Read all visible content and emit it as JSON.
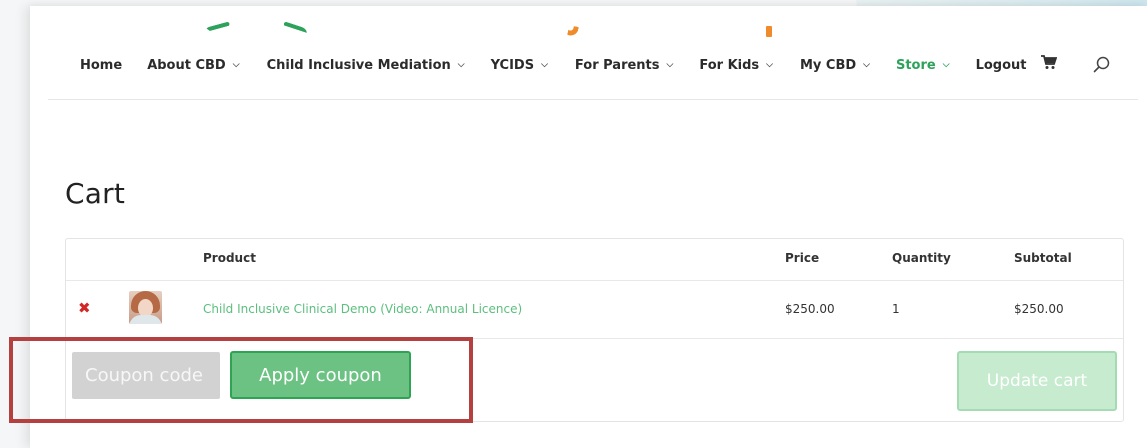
{
  "nav": {
    "items": [
      {
        "label": "Home",
        "has_dropdown": false,
        "active": false
      },
      {
        "label": "About CBD",
        "has_dropdown": true,
        "active": false
      },
      {
        "label": "Child Inclusive Mediation",
        "has_dropdown": true,
        "active": false
      },
      {
        "label": "YCIDS",
        "has_dropdown": true,
        "active": false
      },
      {
        "label": "For Parents",
        "has_dropdown": true,
        "active": false
      },
      {
        "label": "For Kids",
        "has_dropdown": true,
        "active": false
      },
      {
        "label": "My CBD",
        "has_dropdown": true,
        "active": false
      },
      {
        "label": "Store",
        "has_dropdown": true,
        "active": true
      },
      {
        "label": "Logout",
        "has_dropdown": false,
        "active": false
      }
    ],
    "dropdown_icon": "chevron-down-icon",
    "cart_icon": "cart-icon",
    "search_icon": "search-icon",
    "active_color": "#2ca25a"
  },
  "page": {
    "title": "Cart"
  },
  "cart": {
    "columns": {
      "product": "Product",
      "price": "Price",
      "quantity": "Quantity",
      "subtotal": "Subtotal"
    },
    "items": [
      {
        "remove_icon": "close-icon",
        "product_name": "Child Inclusive Clinical Demo (Video: Annual Licence)",
        "price": "$250.00",
        "quantity": "1",
        "subtotal": "$250.00"
      }
    ],
    "coupon": {
      "placeholder": "Coupon code",
      "value": ""
    },
    "apply_coupon_label": "Apply coupon",
    "update_cart_label": "Update cart"
  },
  "colors": {
    "brand_green": "#2ca25a",
    "link_green": "#5cbf7e",
    "button_green": "#6cc283",
    "remove_red": "#d12727",
    "highlight_red": "#b54040"
  }
}
